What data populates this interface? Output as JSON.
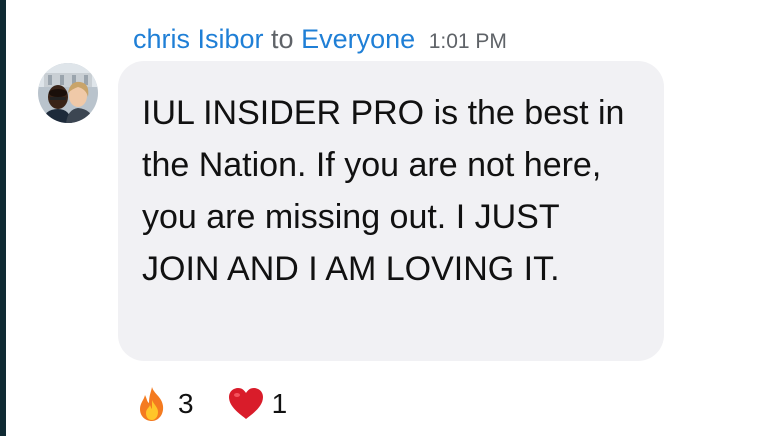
{
  "message": {
    "sender": "chris Isibor",
    "to_word": "to",
    "recipient": "Everyone",
    "time": "1:01 PM",
    "text": "IUL INSIDER PRO is the best in the Nation. If you are not here, you are missing out. I JUST JOIN AND I AM LOVING IT."
  },
  "reactions": [
    {
      "icon": "fire-icon",
      "count": "3"
    },
    {
      "icon": "heart-icon",
      "count": "1"
    }
  ],
  "colors": {
    "name_link": "#1f7fd6",
    "muted_text": "#5f6368",
    "bubble_bg": "#f1f1f4",
    "heart": "#d91c2a",
    "fire": "#f47b20"
  }
}
